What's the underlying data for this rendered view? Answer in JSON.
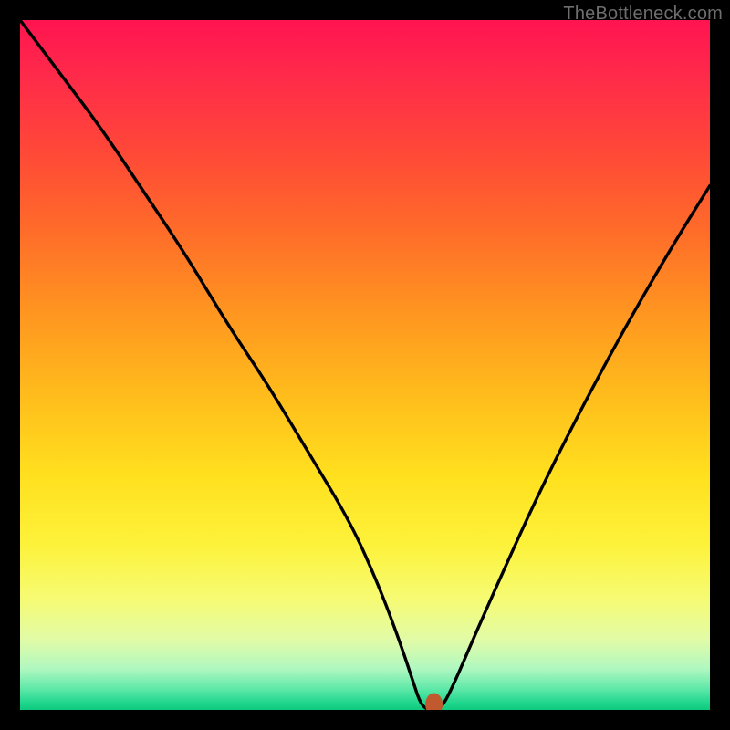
{
  "watermark": "TheBottleneck.com",
  "chart_data": {
    "type": "line",
    "title": "",
    "xlabel": "",
    "ylabel": "",
    "xlim": [
      0,
      100
    ],
    "ylim": [
      0,
      100
    ],
    "grid": false,
    "description": "Bottleneck curve: a V-shaped line on a vertical rainbow heat gradient (red at top through orange/yellow to green at bottom). Minimum bottleneck point highlighted with a small marker near the bottom-center.",
    "series": [
      {
        "name": "bottleneck-curve",
        "x": [
          0,
          6,
          12,
          18,
          24,
          30,
          36,
          42,
          48,
          52,
          55,
          57,
          58,
          59,
          61,
          63,
          66,
          70,
          75,
          81,
          88,
          95,
          100
        ],
        "y": [
          100,
          92,
          84,
          75,
          66,
          56,
          47,
          37,
          27,
          18,
          10,
          4,
          1,
          0,
          0,
          4,
          11,
          20,
          31,
          43,
          56,
          68,
          76
        ]
      }
    ],
    "marker": {
      "x": 60,
      "y": 0.8
    },
    "gradient_stops": [
      {
        "pos": 0,
        "color": "#ff1450"
      },
      {
        "pos": 50,
        "color": "#ffc21c"
      },
      {
        "pos": 85,
        "color": "#f6fb74"
      },
      {
        "pos": 100,
        "color": "#0fc97e"
      }
    ]
  }
}
